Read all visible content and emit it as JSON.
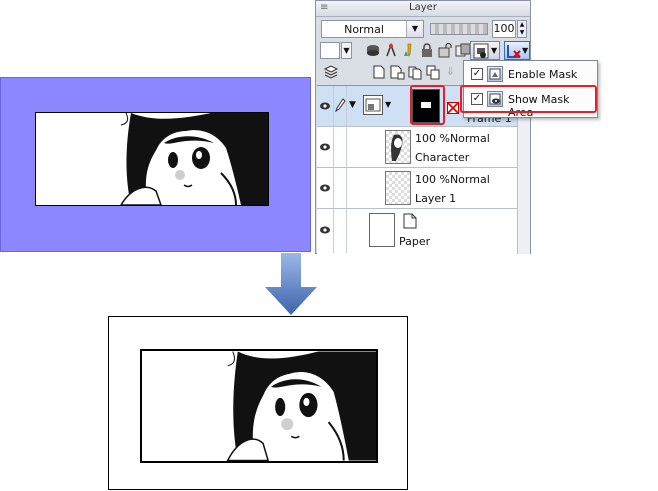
{
  "palette": {
    "title": "Layer",
    "blend_mode": "Normal",
    "opacity": "100"
  },
  "layers": [
    {
      "name": "Frame 1",
      "type": "folder"
    },
    {
      "opacity_mode": "100 %Normal",
      "name": "Character"
    },
    {
      "opacity_mode": "100 %Normal",
      "name": "Layer 1"
    },
    {
      "name": "Paper"
    }
  ],
  "menu": {
    "items": [
      {
        "label": "Enable Mask",
        "checked": true
      },
      {
        "label": "Show Mask Area",
        "checked": true
      }
    ]
  },
  "colors": {
    "mask_area": "#8c87ff",
    "highlight": "#e0202a",
    "arrow": "#5a7fc0"
  }
}
